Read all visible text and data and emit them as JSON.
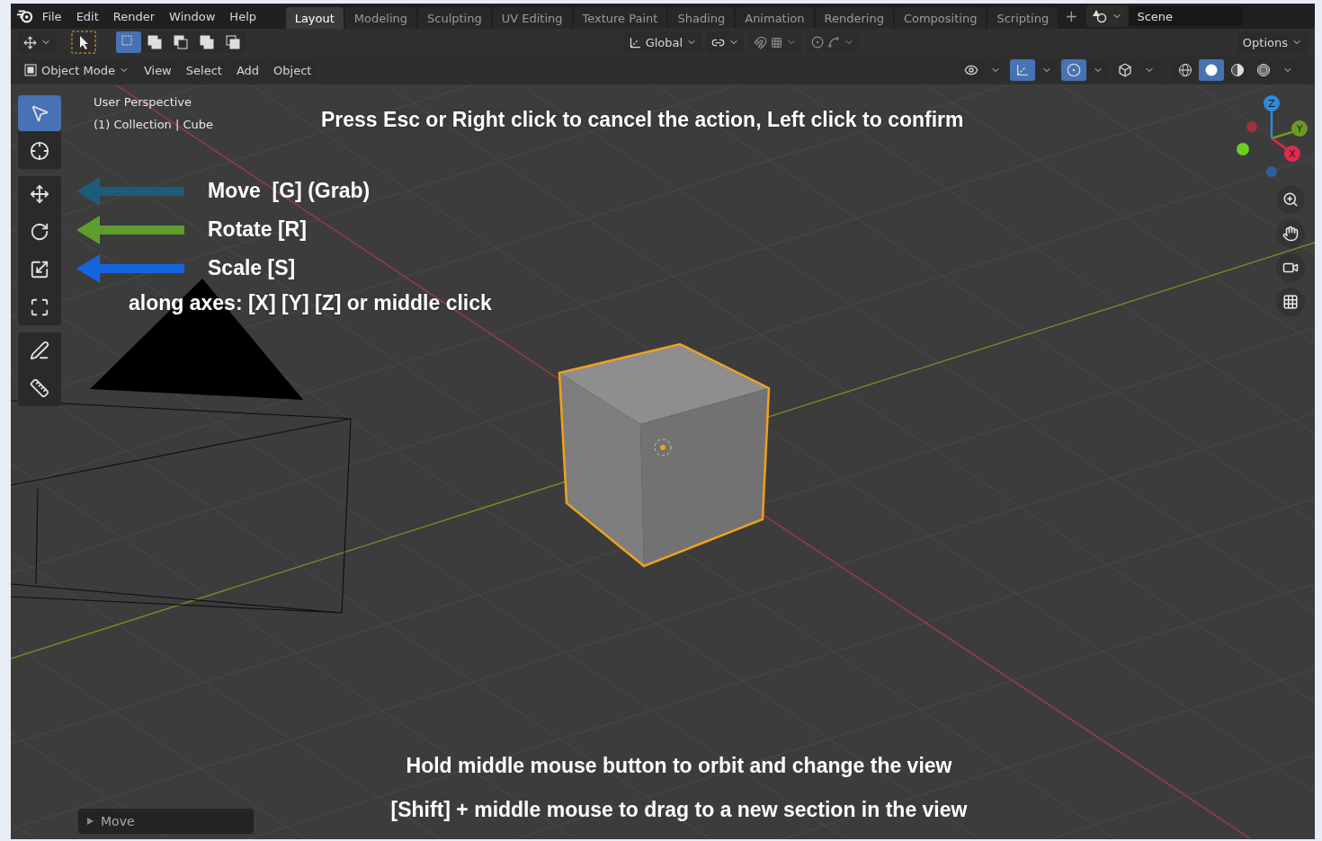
{
  "topbar": {
    "menus": [
      "File",
      "Edit",
      "Render",
      "Window",
      "Help"
    ],
    "workspaces": [
      {
        "label": "Layout",
        "selected": true
      },
      {
        "label": "Modeling",
        "selected": false
      },
      {
        "label": "Sculpting",
        "selected": false
      },
      {
        "label": "UV Editing",
        "selected": false
      },
      {
        "label": "Texture Paint",
        "selected": false
      },
      {
        "label": "Shading",
        "selected": false
      },
      {
        "label": "Animation",
        "selected": false
      },
      {
        "label": "Rendering",
        "selected": false
      },
      {
        "label": "Compositing",
        "selected": false
      },
      {
        "label": "Scripting",
        "selected": false
      }
    ],
    "add_workspace": "+",
    "scene": "Scene"
  },
  "tool_header": {
    "select_modes": [
      {
        "kind": "set",
        "selected": true
      },
      {
        "kind": "extend",
        "selected": false
      },
      {
        "kind": "subtract",
        "selected": false
      },
      {
        "kind": "difference",
        "selected": false
      },
      {
        "kind": "intersect",
        "selected": false
      }
    ],
    "orientation": "Global",
    "snap": {
      "on": false
    },
    "proportional_editing": {
      "on": false
    },
    "options": "Options"
  },
  "viewport_header": {
    "mode": "Object Mode",
    "menus": [
      "View",
      "Select",
      "Add",
      "Object"
    ],
    "toggles": [
      {
        "kind": "selectability",
        "on": false
      },
      {
        "kind": "gizmos",
        "on": true
      },
      {
        "kind": "overlays",
        "on": true
      },
      {
        "kind": "xray",
        "on": false
      }
    ],
    "shading": [
      {
        "kind": "wireframe",
        "selected": false
      },
      {
        "kind": "solid",
        "selected": true
      },
      {
        "kind": "material",
        "selected": false
      },
      {
        "kind": "rendered",
        "selected": false
      }
    ]
  },
  "toolbar": [
    {
      "tools": [
        {
          "kind": "select",
          "selected": true
        },
        {
          "kind": "cursor",
          "selected": false
        }
      ]
    },
    {
      "tools": [
        {
          "kind": "move",
          "selected": false
        },
        {
          "kind": "rotate",
          "selected": false
        },
        {
          "kind": "scale",
          "selected": false
        },
        {
          "kind": "transform",
          "selected": false
        }
      ]
    },
    {
      "tools": [
        {
          "kind": "annotate",
          "selected": false
        },
        {
          "kind": "measure",
          "selected": false
        }
      ]
    }
  ],
  "viewport": {
    "perspective": "User Perspective",
    "collection": "(1) Collection | Cube",
    "gizmo_axes": [
      {
        "label": "Z",
        "color": "#2a8be0"
      },
      {
        "label": "Y",
        "color": "#6a9a22"
      },
      {
        "label": "X",
        "color": "#e8284a"
      }
    ]
  },
  "navigation": [
    {
      "kind": "zoom"
    },
    {
      "kind": "pan"
    },
    {
      "kind": "camera"
    },
    {
      "kind": "ortho"
    }
  ],
  "instructions": {
    "cancel": "Press Esc or Right click to cancel the action, Left click to confirm",
    "shortcuts": [
      {
        "text": "Move  [G] (Grab)",
        "color": "#1b5c78"
      },
      {
        "text": "Rotate [R]",
        "color": "#5e9e2e"
      },
      {
        "text": "Scale [S]",
        "color": "#1565df"
      }
    ],
    "axes_hint": "along axes: [X] [Y] [Z] or middle click",
    "orbit_hint": "Hold middle mouse button to orbit and change the view",
    "pan_hint": "[Shift] + middle mouse to drag to a new section in the view"
  },
  "last_operator": "Move"
}
